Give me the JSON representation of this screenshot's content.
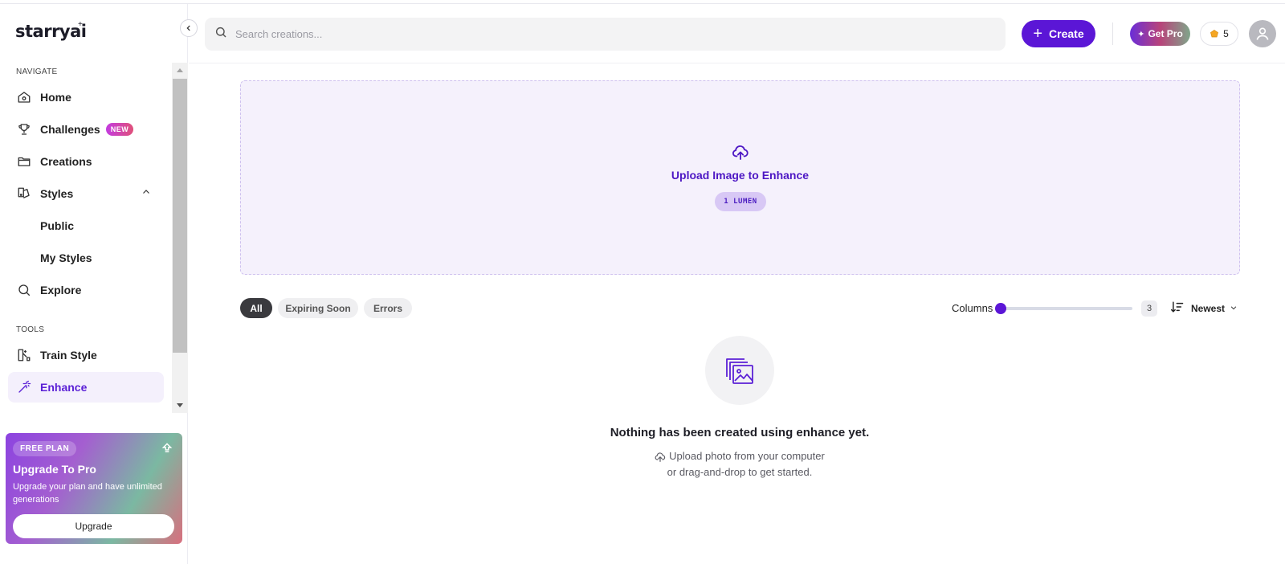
{
  "brand": {
    "name": "starryai",
    "mark": "+"
  },
  "sidebar": {
    "navigate_label": "NAVIGATE",
    "tools_label": "TOOLS",
    "items": [
      {
        "label": "Home",
        "icon": "home-icon"
      },
      {
        "label": "Challenges",
        "icon": "trophy-icon",
        "badge": "NEW"
      },
      {
        "label": "Creations",
        "icon": "folder-icon"
      },
      {
        "label": "Styles",
        "icon": "palette-icon"
      },
      {
        "label": "Public"
      },
      {
        "label": "My Styles"
      },
      {
        "label": "Explore",
        "icon": "search-icon"
      }
    ],
    "tools": [
      {
        "label": "Train Style",
        "icon": "train-style-icon"
      },
      {
        "label": "Enhance",
        "icon": "magic-wand-icon",
        "active": true
      }
    ]
  },
  "promo": {
    "chip": "FREE PLAN",
    "title": "Upgrade To Pro",
    "text": "Upgrade your plan and have unlimited generations",
    "button": "Upgrade"
  },
  "header": {
    "search_placeholder": "Search creations...",
    "create_label": "Create",
    "getpro_label": "Get Pro",
    "lumens": "5"
  },
  "upload": {
    "title": "Upload Image to Enhance",
    "cost": "1 LUMEN"
  },
  "filters": {
    "chips": [
      "All",
      "Expiring Soon",
      "Errors"
    ],
    "active": "All",
    "columns_label": "Columns",
    "columns_value": "3",
    "sort_label": "Newest"
  },
  "empty": {
    "title": "Nothing has been created using enhance yet.",
    "line1": "Upload photo from your computer",
    "line2": "or drag-and-drop to get started."
  },
  "colors": {
    "accent": "#5b16d6",
    "active_bg": "#f4f0fc",
    "upload_bg": "#f5f1fc"
  }
}
